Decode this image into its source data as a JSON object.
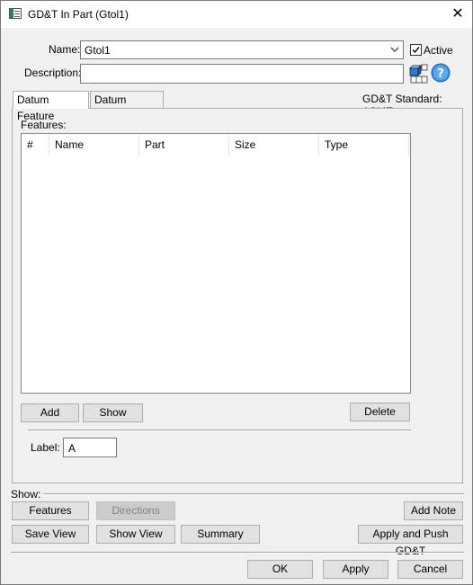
{
  "window": {
    "title": "GD&T In Part (Gtol1)",
    "close_label": "✕"
  },
  "form": {
    "name_label": "Name:",
    "name_value": "Gtol1",
    "active_label": "Active",
    "active_checked": true,
    "description_label": "Description:",
    "description_value": ""
  },
  "tabs": [
    {
      "label": "Datum Feature",
      "active": true
    },
    {
      "label": "Datum Targets",
      "active": false
    }
  ],
  "standard_text": "GD&T Standard: ASME",
  "features": {
    "label": "Features:",
    "columns": [
      "#",
      "Name",
      "Part",
      "Size",
      "Type"
    ],
    "rows": [],
    "add_label": "Add",
    "show_label": "Show",
    "delete_label": "Delete"
  },
  "label_field": {
    "label": "Label:",
    "value": "A"
  },
  "show_section": {
    "label": "Show:",
    "features": "Features",
    "directions": "Directions",
    "add_note": "Add Note",
    "save_view": "Save View",
    "show_view": "Show View",
    "summary": "Summary",
    "apply_push": "Apply and Push GD&T"
  },
  "footer": {
    "ok": "OK",
    "apply": "Apply",
    "cancel": "Cancel"
  },
  "icons": {
    "title": "window-icon",
    "cube": "parts-icon",
    "help": "help-icon",
    "dropdown": "chevron-down-icon"
  }
}
